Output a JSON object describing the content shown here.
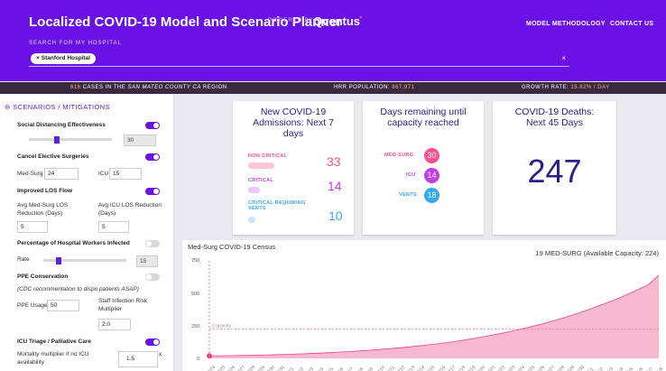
{
  "header": {
    "title": "Localized COVID-19 Model and Scenario Planner",
    "powered_by": "POWERED BY",
    "brand": "Qventus",
    "nav": [
      "MODEL METHODOLOGY",
      "CONTACT US"
    ],
    "search_label": "SEARCH FOR MY HOSPITAL",
    "selected_hospital": "Stanford Hospital"
  },
  "stats": {
    "cases_value": "616",
    "cases_text_a": "CASES IN THE",
    "cases_region": "SAN MATEO COUNTY CA",
    "cases_text_b": "REGION",
    "pop_label": "HRR POPULATION:",
    "pop_value": "867,971",
    "growth_label": "GROWTH RATE:",
    "growth_value": "15.82% / DAY"
  },
  "sidebar": {
    "section_title": "SCENARIOS / MITIGATIONS",
    "social_distancing": {
      "label": "Social Distancing Effectiveness",
      "value": "30",
      "level": 0.3
    },
    "elective": {
      "label": "Cancel Elective Surgeries",
      "medsurg_label": "Med-Surg",
      "medsurg_value": "24",
      "icu_label": "ICU",
      "icu_value": "15"
    },
    "los": {
      "label": "Improved LOS Flow",
      "medsurg_label_1": "Avg Med-Surg LOS",
      "medsurg_label_2": "Reduction (Days)",
      "medsurg_value": "5",
      "icu_label_1": "Avg ICU LOS Reduction",
      "icu_label_2": "(Days)",
      "icu_value": "5"
    },
    "workers": {
      "label": "Percentage of Hospital Workers Infected",
      "rate_label": "Rate",
      "value": "15",
      "level": 0.15
    },
    "ppe": {
      "label": "PPE Conservation",
      "note": "(CDC recommentation to dispo patients ASAP)",
      "usage_label": "PPE Usage",
      "usage_value": "50",
      "risk_label_1": "Staff Infection Risk",
      "risk_label_2": "Multiplier",
      "risk_value": "2.0"
    },
    "icu_triage": {
      "label": "ICU Triage / Palliative Care",
      "mort_label_1": "Mortality multiplier if no ICU",
      "mort_label_2": "availability",
      "mort_value": "1.5",
      "x": "x"
    }
  },
  "cards": {
    "admissions": {
      "title_1": "New COVID-19",
      "title_2": "Admissions: Next 7",
      "title_3": "days",
      "noncritical_label": "NON-CRITICAL",
      "noncritical_value": "33",
      "critical_label": "CRITICAL",
      "critical_value": "14",
      "vents_label_1": "CRITICAL REQUIRING",
      "vents_label_2": "VENTS",
      "vents_value": "10"
    },
    "capacity": {
      "title_1": "Days remaining until",
      "title_2": "capacity reached",
      "medsurg_label": "MED-SURG",
      "medsurg_value": "30",
      "icu_label": "ICU",
      "icu_value": "14",
      "vents_label": "VENTS",
      "vents_value": "18"
    },
    "deaths": {
      "title_1": "COVID-19 Deaths:",
      "title_2": "Next 45 Days",
      "value": "247"
    }
  },
  "chart_data": {
    "type": "area",
    "title": "Med-Surg COVID-19 Census",
    "legend": "19 MED-SURG (Available Capacity: 224)",
    "capacity_label": "Capacity",
    "capacity": 224,
    "ylim": [
      0,
      750
    ],
    "yticks": [
      "0",
      "250",
      "500",
      "750"
    ],
    "x": [
      "3/24",
      "3/25",
      "3/26",
      "3/27",
      "3/28",
      "3/29",
      "3/30",
      "3/31",
      "4/1",
      "4/2",
      "4/3",
      "4/4",
      "4/5",
      "4/6",
      "4/7",
      "4/8",
      "4/9",
      "4/10",
      "4/11",
      "4/12",
      "4/13",
      "4/14",
      "4/15",
      "4/16",
      "4/17",
      "4/18",
      "4/19",
      "4/20",
      "4/21",
      "4/22",
      "4/23",
      "4/24",
      "4/25",
      "4/26",
      "4/27",
      "4/28",
      "4/29",
      "4/30",
      "5/1",
      "5/2",
      "5/3",
      "5/4",
      "5/5",
      "5/6",
      "5/7",
      "5/8"
    ],
    "values": [
      19,
      20,
      21,
      22,
      23,
      25,
      27,
      29,
      31,
      34,
      37,
      40,
      44,
      48,
      52,
      57,
      62,
      68,
      74,
      81,
      88,
      96,
      105,
      114,
      124,
      135,
      147,
      160,
      174,
      189,
      205,
      222,
      240,
      259,
      280,
      302,
      325,
      350,
      376,
      404,
      433,
      464,
      497,
      532,
      569,
      640
    ],
    "colors": {
      "fill": "#f7b9d0",
      "line": "#e8458a",
      "capacity": "#e8458a"
    }
  },
  "colors": {
    "header": "#6a12e6",
    "accent": "#5a22d9",
    "noncritical": "#ff4f8f",
    "critical": "#c13ee6",
    "vents": "#33a9f0",
    "title_blue": "#2a1d8f"
  }
}
